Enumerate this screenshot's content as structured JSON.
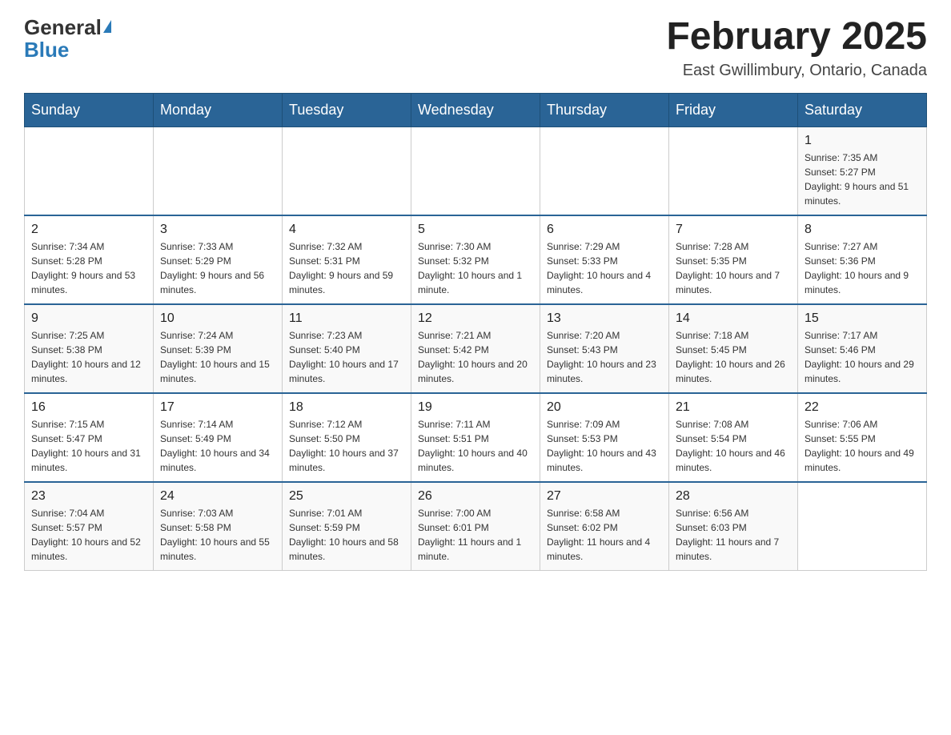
{
  "header": {
    "logo_general": "General",
    "logo_blue": "Blue",
    "month_title": "February 2025",
    "location": "East Gwillimbury, Ontario, Canada"
  },
  "days_of_week": [
    "Sunday",
    "Monday",
    "Tuesday",
    "Wednesday",
    "Thursday",
    "Friday",
    "Saturday"
  ],
  "weeks": [
    [
      {
        "day": "",
        "sunrise": "",
        "sunset": "",
        "daylight": ""
      },
      {
        "day": "",
        "sunrise": "",
        "sunset": "",
        "daylight": ""
      },
      {
        "day": "",
        "sunrise": "",
        "sunset": "",
        "daylight": ""
      },
      {
        "day": "",
        "sunrise": "",
        "sunset": "",
        "daylight": ""
      },
      {
        "day": "",
        "sunrise": "",
        "sunset": "",
        "daylight": ""
      },
      {
        "day": "",
        "sunrise": "",
        "sunset": "",
        "daylight": ""
      },
      {
        "day": "1",
        "sunrise": "Sunrise: 7:35 AM",
        "sunset": "Sunset: 5:27 PM",
        "daylight": "Daylight: 9 hours and 51 minutes."
      }
    ],
    [
      {
        "day": "2",
        "sunrise": "Sunrise: 7:34 AM",
        "sunset": "Sunset: 5:28 PM",
        "daylight": "Daylight: 9 hours and 53 minutes."
      },
      {
        "day": "3",
        "sunrise": "Sunrise: 7:33 AM",
        "sunset": "Sunset: 5:29 PM",
        "daylight": "Daylight: 9 hours and 56 minutes."
      },
      {
        "day": "4",
        "sunrise": "Sunrise: 7:32 AM",
        "sunset": "Sunset: 5:31 PM",
        "daylight": "Daylight: 9 hours and 59 minutes."
      },
      {
        "day": "5",
        "sunrise": "Sunrise: 7:30 AM",
        "sunset": "Sunset: 5:32 PM",
        "daylight": "Daylight: 10 hours and 1 minute."
      },
      {
        "day": "6",
        "sunrise": "Sunrise: 7:29 AM",
        "sunset": "Sunset: 5:33 PM",
        "daylight": "Daylight: 10 hours and 4 minutes."
      },
      {
        "day": "7",
        "sunrise": "Sunrise: 7:28 AM",
        "sunset": "Sunset: 5:35 PM",
        "daylight": "Daylight: 10 hours and 7 minutes."
      },
      {
        "day": "8",
        "sunrise": "Sunrise: 7:27 AM",
        "sunset": "Sunset: 5:36 PM",
        "daylight": "Daylight: 10 hours and 9 minutes."
      }
    ],
    [
      {
        "day": "9",
        "sunrise": "Sunrise: 7:25 AM",
        "sunset": "Sunset: 5:38 PM",
        "daylight": "Daylight: 10 hours and 12 minutes."
      },
      {
        "day": "10",
        "sunrise": "Sunrise: 7:24 AM",
        "sunset": "Sunset: 5:39 PM",
        "daylight": "Daylight: 10 hours and 15 minutes."
      },
      {
        "day": "11",
        "sunrise": "Sunrise: 7:23 AM",
        "sunset": "Sunset: 5:40 PM",
        "daylight": "Daylight: 10 hours and 17 minutes."
      },
      {
        "day": "12",
        "sunrise": "Sunrise: 7:21 AM",
        "sunset": "Sunset: 5:42 PM",
        "daylight": "Daylight: 10 hours and 20 minutes."
      },
      {
        "day": "13",
        "sunrise": "Sunrise: 7:20 AM",
        "sunset": "Sunset: 5:43 PM",
        "daylight": "Daylight: 10 hours and 23 minutes."
      },
      {
        "day": "14",
        "sunrise": "Sunrise: 7:18 AM",
        "sunset": "Sunset: 5:45 PM",
        "daylight": "Daylight: 10 hours and 26 minutes."
      },
      {
        "day": "15",
        "sunrise": "Sunrise: 7:17 AM",
        "sunset": "Sunset: 5:46 PM",
        "daylight": "Daylight: 10 hours and 29 minutes."
      }
    ],
    [
      {
        "day": "16",
        "sunrise": "Sunrise: 7:15 AM",
        "sunset": "Sunset: 5:47 PM",
        "daylight": "Daylight: 10 hours and 31 minutes."
      },
      {
        "day": "17",
        "sunrise": "Sunrise: 7:14 AM",
        "sunset": "Sunset: 5:49 PM",
        "daylight": "Daylight: 10 hours and 34 minutes."
      },
      {
        "day": "18",
        "sunrise": "Sunrise: 7:12 AM",
        "sunset": "Sunset: 5:50 PM",
        "daylight": "Daylight: 10 hours and 37 minutes."
      },
      {
        "day": "19",
        "sunrise": "Sunrise: 7:11 AM",
        "sunset": "Sunset: 5:51 PM",
        "daylight": "Daylight: 10 hours and 40 minutes."
      },
      {
        "day": "20",
        "sunrise": "Sunrise: 7:09 AM",
        "sunset": "Sunset: 5:53 PM",
        "daylight": "Daylight: 10 hours and 43 minutes."
      },
      {
        "day": "21",
        "sunrise": "Sunrise: 7:08 AM",
        "sunset": "Sunset: 5:54 PM",
        "daylight": "Daylight: 10 hours and 46 minutes."
      },
      {
        "day": "22",
        "sunrise": "Sunrise: 7:06 AM",
        "sunset": "Sunset: 5:55 PM",
        "daylight": "Daylight: 10 hours and 49 minutes."
      }
    ],
    [
      {
        "day": "23",
        "sunrise": "Sunrise: 7:04 AM",
        "sunset": "Sunset: 5:57 PM",
        "daylight": "Daylight: 10 hours and 52 minutes."
      },
      {
        "day": "24",
        "sunrise": "Sunrise: 7:03 AM",
        "sunset": "Sunset: 5:58 PM",
        "daylight": "Daylight: 10 hours and 55 minutes."
      },
      {
        "day": "25",
        "sunrise": "Sunrise: 7:01 AM",
        "sunset": "Sunset: 5:59 PM",
        "daylight": "Daylight: 10 hours and 58 minutes."
      },
      {
        "day": "26",
        "sunrise": "Sunrise: 7:00 AM",
        "sunset": "Sunset: 6:01 PM",
        "daylight": "Daylight: 11 hours and 1 minute."
      },
      {
        "day": "27",
        "sunrise": "Sunrise: 6:58 AM",
        "sunset": "Sunset: 6:02 PM",
        "daylight": "Daylight: 11 hours and 4 minutes."
      },
      {
        "day": "28",
        "sunrise": "Sunrise: 6:56 AM",
        "sunset": "Sunset: 6:03 PM",
        "daylight": "Daylight: 11 hours and 7 minutes."
      },
      {
        "day": "",
        "sunrise": "",
        "sunset": "",
        "daylight": ""
      }
    ]
  ]
}
